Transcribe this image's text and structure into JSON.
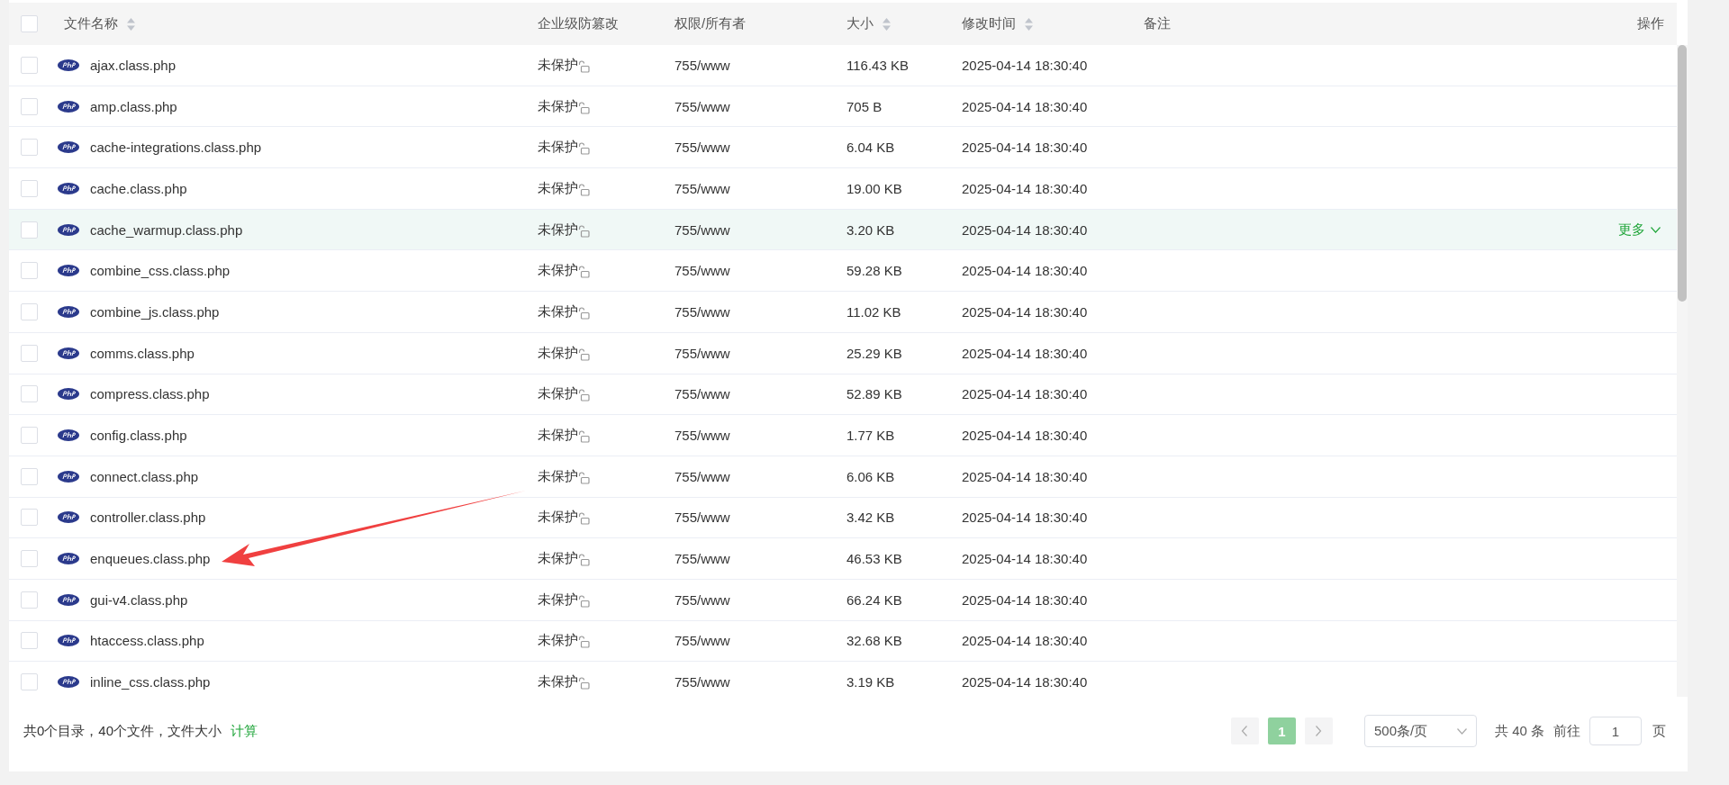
{
  "table": {
    "select_all_checked": false,
    "columns": [
      {
        "label": "文件名称",
        "sortable": true
      },
      {
        "label": "企业级防篡改",
        "sortable": false
      },
      {
        "label": "权限/所有者",
        "sortable": false
      },
      {
        "label": "大小",
        "sortable": true
      },
      {
        "label": "修改时间",
        "sortable": true
      },
      {
        "label": "备注",
        "sortable": false
      },
      {
        "label": "操作",
        "sortable": false
      }
    ],
    "rows": [
      {
        "name": "ajax.class.php",
        "protection": "未保护",
        "permission": "755/www",
        "size": "116.43 KB",
        "modified": "2025-04-14 18:30:40",
        "checked": false,
        "hovered": false
      },
      {
        "name": "amp.class.php",
        "protection": "未保护",
        "permission": "755/www",
        "size": "705 B",
        "modified": "2025-04-14 18:30:40",
        "checked": false,
        "hovered": false
      },
      {
        "name": "cache-integrations.class.php",
        "protection": "未保护",
        "permission": "755/www",
        "size": "6.04 KB",
        "modified": "2025-04-14 18:30:40",
        "checked": false,
        "hovered": false
      },
      {
        "name": "cache.class.php",
        "protection": "未保护",
        "permission": "755/www",
        "size": "19.00 KB",
        "modified": "2025-04-14 18:30:40",
        "checked": false,
        "hovered": false
      },
      {
        "name": "cache_warmup.class.php",
        "protection": "未保护",
        "permission": "755/www",
        "size": "3.20 KB",
        "modified": "2025-04-14 18:30:40",
        "checked": false,
        "hovered": true,
        "action": "更多"
      },
      {
        "name": "combine_css.class.php",
        "protection": "未保护",
        "permission": "755/www",
        "size": "59.28 KB",
        "modified": "2025-04-14 18:30:40",
        "checked": false,
        "hovered": false
      },
      {
        "name": "combine_js.class.php",
        "protection": "未保护",
        "permission": "755/www",
        "size": "11.02 KB",
        "modified": "2025-04-14 18:30:40",
        "checked": false,
        "hovered": false
      },
      {
        "name": "comms.class.php",
        "protection": "未保护",
        "permission": "755/www",
        "size": "25.29 KB",
        "modified": "2025-04-14 18:30:40",
        "checked": false,
        "hovered": false
      },
      {
        "name": "compress.class.php",
        "protection": "未保护",
        "permission": "755/www",
        "size": "52.89 KB",
        "modified": "2025-04-14 18:30:40",
        "checked": false,
        "hovered": false
      },
      {
        "name": "config.class.php",
        "protection": "未保护",
        "permission": "755/www",
        "size": "1.77 KB",
        "modified": "2025-04-14 18:30:40",
        "checked": false,
        "hovered": false
      },
      {
        "name": "connect.class.php",
        "protection": "未保护",
        "permission": "755/www",
        "size": "6.06 KB",
        "modified": "2025-04-14 18:30:40",
        "checked": false,
        "hovered": false
      },
      {
        "name": "controller.class.php",
        "protection": "未保护",
        "permission": "755/www",
        "size": "3.42 KB",
        "modified": "2025-04-14 18:30:40",
        "checked": false,
        "hovered": false
      },
      {
        "name": "enqueues.class.php",
        "protection": "未保护",
        "permission": "755/www",
        "size": "46.53 KB",
        "modified": "2025-04-14 18:30:40",
        "checked": false,
        "hovered": false
      },
      {
        "name": "gui-v4.class.php",
        "protection": "未保护",
        "permission": "755/www",
        "size": "66.24 KB",
        "modified": "2025-04-14 18:30:40",
        "checked": false,
        "hovered": false
      },
      {
        "name": "htaccess.class.php",
        "protection": "未保护",
        "permission": "755/www",
        "size": "32.68 KB",
        "modified": "2025-04-14 18:30:40",
        "checked": false,
        "hovered": false
      },
      {
        "name": "inline_css.class.php",
        "protection": "未保护",
        "permission": "755/www",
        "size": "3.19 KB",
        "modified": "2025-04-14 18:30:40",
        "checked": false,
        "hovered": false
      }
    ]
  },
  "footer": {
    "summary": "共0个目录，40个文件，文件大小",
    "calculate_link": "计算"
  },
  "pagination": {
    "pages": [
      {
        "label": "1",
        "selected": true
      }
    ],
    "page_size": "500条/页",
    "total": "共 40 条",
    "goto_label": "前往",
    "goto_value": "1",
    "page_unit": "页"
  }
}
